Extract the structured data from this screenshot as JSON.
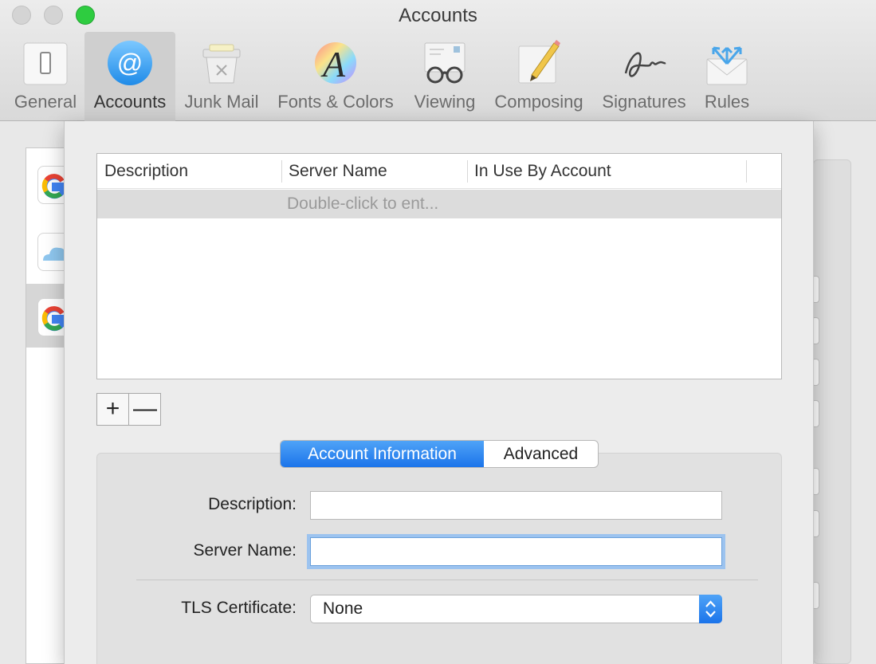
{
  "window": {
    "title": "Accounts"
  },
  "toolbar": {
    "items": [
      {
        "label": "General",
        "icon": "general-switch-icon"
      },
      {
        "label": "Accounts",
        "icon": "at-sign-icon",
        "active": true
      },
      {
        "label": "Junk Mail",
        "icon": "trash-can-icon"
      },
      {
        "label": "Fonts & Colors",
        "icon": "fonts-colors-icon"
      },
      {
        "label": "Viewing",
        "icon": "glasses-icon"
      },
      {
        "label": "Composing",
        "icon": "pencil-icon"
      },
      {
        "label": "Signatures",
        "icon": "signature-icon"
      },
      {
        "label": "Rules",
        "icon": "rules-envelope-icon"
      }
    ]
  },
  "account_list": {
    "items": [
      {
        "icon": "google-icon"
      },
      {
        "icon": "icloud-icon"
      },
      {
        "icon": "google-icon",
        "selected": true
      }
    ]
  },
  "server_table": {
    "columns": [
      "Description",
      "Server Name",
      "In Use By Account"
    ],
    "placeholder_row": "Double-click to ent..."
  },
  "table_buttons": {
    "add": "+",
    "remove": "—"
  },
  "tabs": {
    "active": "Account Information",
    "inactive": "Advanced"
  },
  "form": {
    "description_label": "Description:",
    "description_value": "",
    "server_name_label": "Server Name:",
    "server_name_value": "",
    "tls_label": "TLS Certificate:",
    "tls_value": "None"
  },
  "colors": {
    "accent": "#1b74ea",
    "close": "#d4d4d4",
    "zoom": "#2ecc40"
  }
}
